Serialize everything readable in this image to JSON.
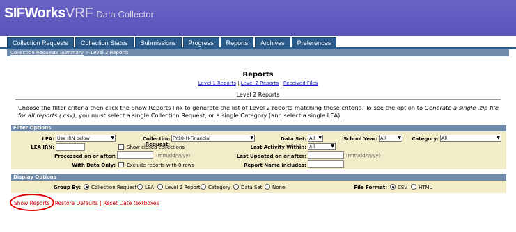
{
  "brand": {
    "part1": "SIFWorks",
    "part2": "VRF",
    "part3": "Data Collector"
  },
  "tabs": [
    "Collection Requests",
    "Collection Status",
    "Submissions",
    "Progress",
    "Reports",
    "Archives",
    "Preferences"
  ],
  "breadcrumb": {
    "link": "Collection Requests Summary",
    "current": " > Level 2 Reports"
  },
  "page": {
    "title": "Reports",
    "links": {
      "level1": "Level 1 Reports",
      "level2": "Level 2 Reports",
      "received": "Received Files",
      "sep": " | "
    },
    "heading": "Level 2 Reports",
    "instructions_a": "Choose the filter criteria then click the Show Reports link to generate the list of Level 2 reports matching these criteria. To see the option to ",
    "instructions_i": "Generate a single .zip file for all reports (.csv)",
    "instructions_b": ", you must select a single Collection Request, or a single Category (and select a single LEA)."
  },
  "filter": {
    "title": "Filter Options",
    "lea_label": "LEA:",
    "lea_value": "Use IRN below",
    "collection_label": "Collection Request:",
    "collection_value": "FY18-H-Financial",
    "dataset_label": "Data Set:",
    "dataset_value": "All",
    "year_label": "School Year:",
    "year_value": "All",
    "category_label": "Category:",
    "category_value": "All",
    "irn_label": "LEA IRN:",
    "closed_label": "Show closed collections",
    "activity_label": "Last Activity Within:",
    "activity_value": "All",
    "processed_label": "Processed on or after:",
    "processed_hint": "(mm/dd/yyyy)",
    "updated_label": "Last Updated on or after:",
    "updated_hint": "(mm/dd/yyyy)",
    "withdata_label": "With Data Only:",
    "exclude_label": "Exclude reports with 0 rows",
    "name_label": "Report Name includes:"
  },
  "display": {
    "title": "Display Options",
    "groupby_label": "Group By:",
    "groupby_options": [
      "Collection Request",
      "LEA",
      "Level 2 Report",
      "Category",
      "Data Set",
      "None"
    ],
    "format_label": "File Format:",
    "format_options": [
      "CSV",
      "HTML"
    ]
  },
  "actions": {
    "show": "Show Reports",
    "restore": "Restore Defaults",
    "reset": "Reset Date textboxes",
    "sep": " | "
  }
}
